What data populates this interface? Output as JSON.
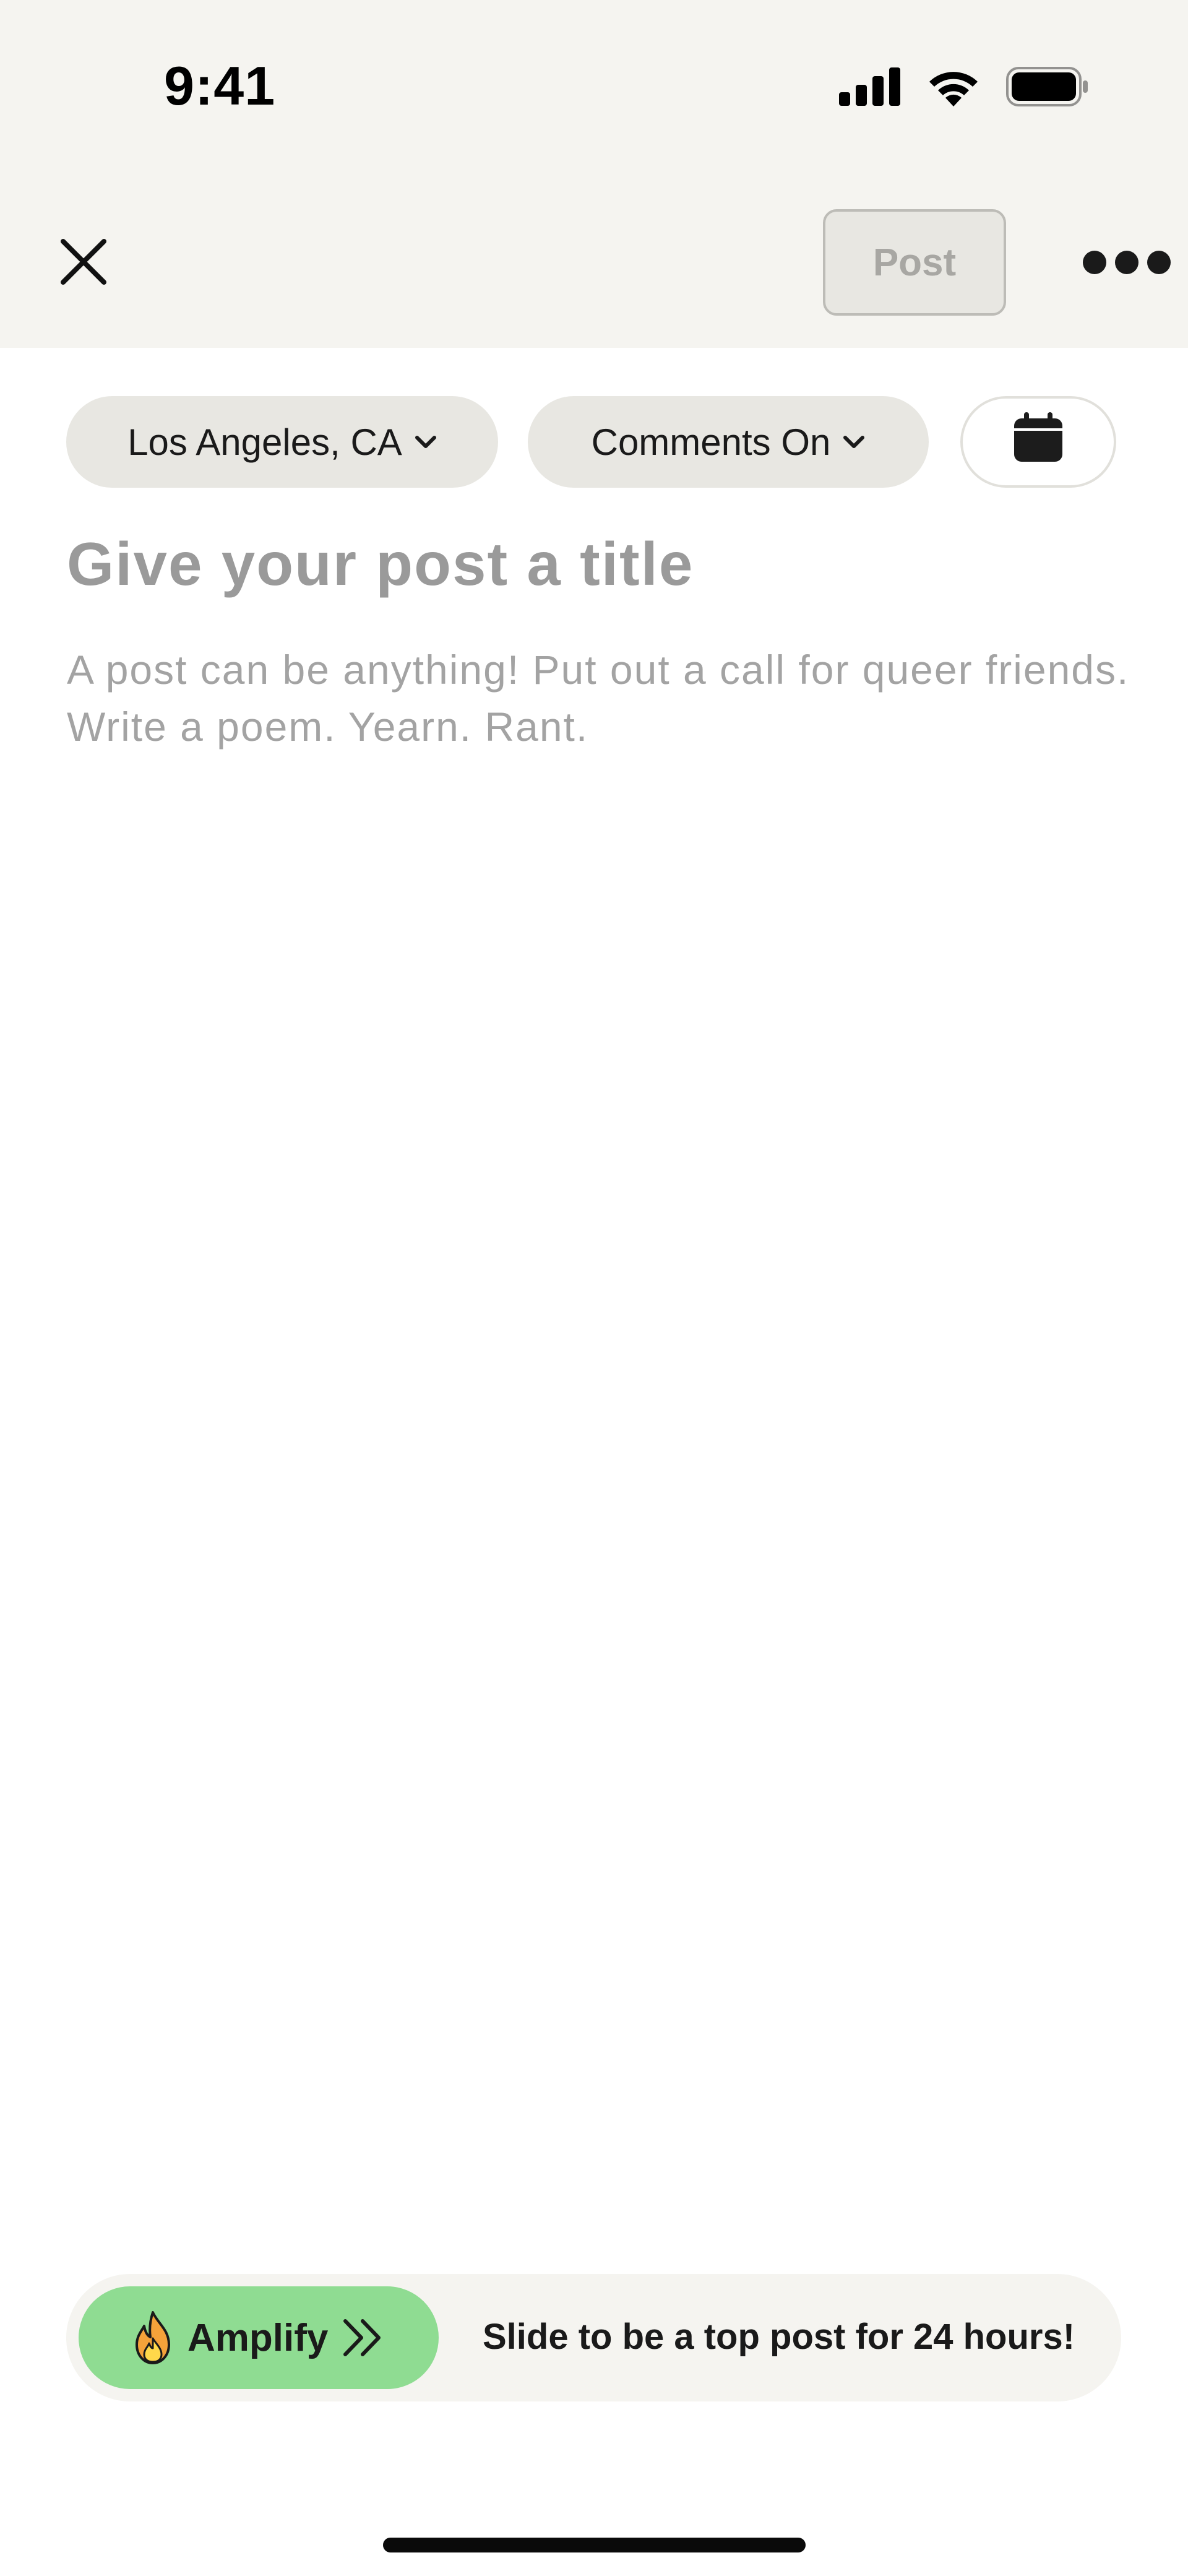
{
  "status_bar": {
    "time": "9:41",
    "signal_icon": "cellular-signal-icon",
    "wifi_icon": "wifi-icon",
    "battery_icon": "battery-icon"
  },
  "header": {
    "close_icon": "close-icon",
    "post_label": "Post",
    "post_enabled": false,
    "more_icon": "more-options-icon"
  },
  "options": {
    "location_label": "Los Angeles, CA",
    "comments_label": "Comments On",
    "chevron_icon": "chevron-down-icon",
    "calendar_icon": "calendar-icon"
  },
  "composer": {
    "title_placeholder": "Give your post a title",
    "body_placeholder": "A post can be anything! Put out a call for queer friends. Write a poem. Yearn. Rant."
  },
  "amplify": {
    "button_label": "Amplify",
    "fire_icon": "fire-icon",
    "arrows_icon": "double-chevron-right-icon",
    "hint": "Slide to be a top post for 24 hours!",
    "accent_color": "#8fdc92"
  },
  "colors": {
    "header_background": "#f5f4f0",
    "chip_background": "#e8e7e2",
    "placeholder_text": "#9a9a9a"
  }
}
